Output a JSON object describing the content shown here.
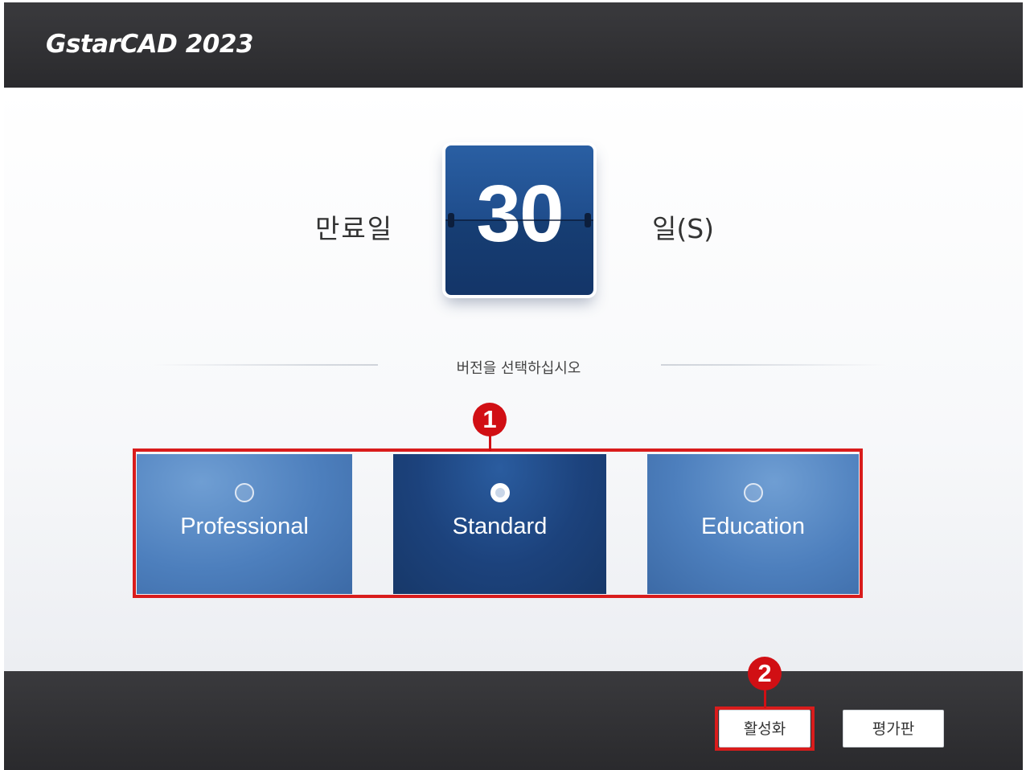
{
  "header": {
    "logo_text": "GstarCAD 2023"
  },
  "expiry": {
    "label": "만료일",
    "days_value": "30",
    "unit_label": "일(S)"
  },
  "version_select": {
    "prompt": "버전을 선택하십시오",
    "options": [
      {
        "label": "Professional",
        "selected": false
      },
      {
        "label": "Standard",
        "selected": true
      },
      {
        "label": "Education",
        "selected": false
      }
    ]
  },
  "callouts": {
    "one": "1",
    "two": "2"
  },
  "footer": {
    "activate_label": "활성화",
    "trial_label": "평가판"
  },
  "colors": {
    "header_bg": "#2f2f32",
    "accent_dark_blue": "#1c427c",
    "accent_light_blue": "#4d7fbd",
    "highlight_red": "#d91c1c"
  }
}
